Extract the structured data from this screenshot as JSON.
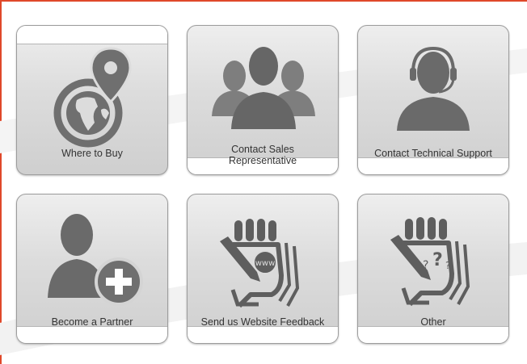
{
  "colors": {
    "frame": "#e0482a",
    "icon": "#6f6f6f",
    "icon_dark": "#5e5e5e"
  },
  "tiles": [
    {
      "label": "Where to Buy",
      "icon": "globe-location-icon"
    },
    {
      "label": "Contact Sales Representative",
      "icon": "group-users-icon"
    },
    {
      "label": "Contact Technical Support",
      "icon": "headset-user-icon"
    },
    {
      "label": "Become a Partner",
      "icon": "add-user-icon"
    },
    {
      "label": "Send us Website Feedback",
      "icon": "hand-pen-www-icon"
    },
    {
      "label": "Other",
      "icon": "hand-pen-question-icon"
    }
  ]
}
